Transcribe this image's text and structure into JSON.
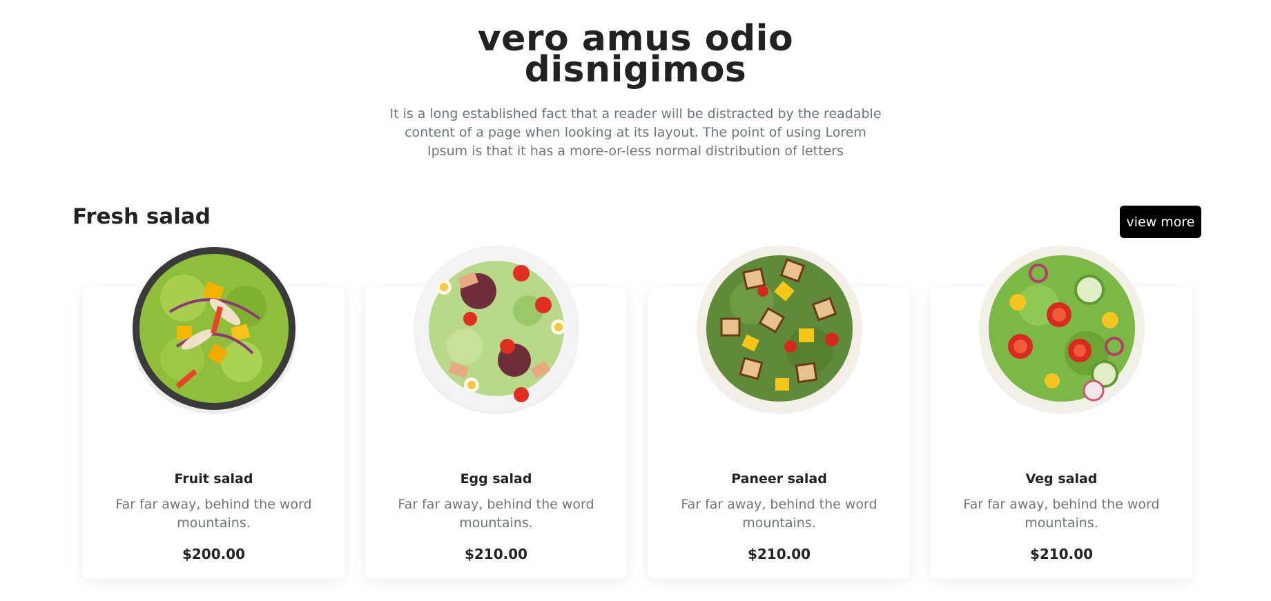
{
  "hero": {
    "title_line1": "vero amus odio",
    "title_line2": "disnigimos",
    "description": "It is a long established fact that a reader will be distracted by the readable content of a page when looking at its layout. The point of using Lorem Ipsum is that it has a more-or-less normal distribution of letters"
  },
  "section": {
    "title": "Fresh salad",
    "view_more_label": "view more"
  },
  "products": [
    {
      "name": "Fruit salad",
      "description": "Far far away, behind the word mountains.",
      "price": "$200.00"
    },
    {
      "name": "Egg salad",
      "description": "Far far away, behind the word mountains.",
      "price": "$210.00"
    },
    {
      "name": "Paneer salad",
      "description": "Far far away, behind the word mountains.",
      "price": "$210.00"
    },
    {
      "name": "Veg salad",
      "description": "Far far away, behind the word mountains.",
      "price": "$210.00"
    }
  ],
  "colors": {
    "button_bg": "#000000",
    "heading": "#222222",
    "muted_text": "#6c757d"
  }
}
